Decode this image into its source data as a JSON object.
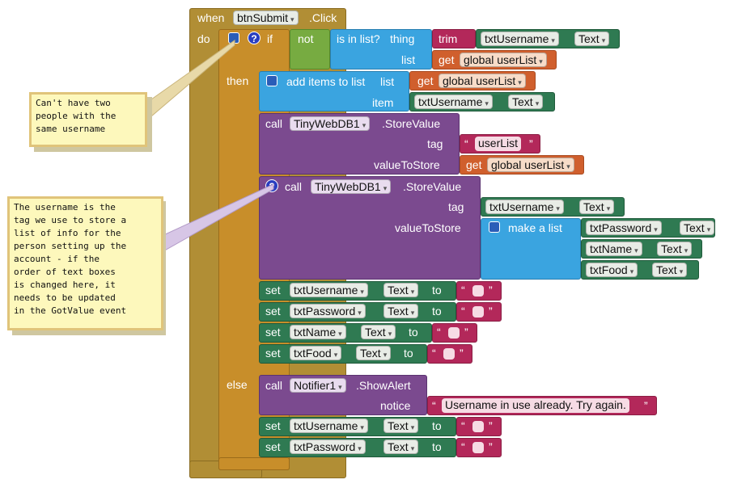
{
  "event": {
    "when": "when",
    "component": "btnSubmit",
    "event": ".Click",
    "do": "do"
  },
  "if_block": {
    "if": "if",
    "not": "not",
    "is_in_list": "is in list?",
    "thing": "thing",
    "list": "list",
    "trim": "trim",
    "then": "then",
    "else": "else"
  },
  "getters": {
    "get": "get",
    "user_list": "global userList"
  },
  "text_prop": "Text",
  "components": {
    "username": "txtUsername",
    "password": "txtPassword",
    "name": "txtName",
    "food": "txtFood",
    "db": "TinyWebDB1",
    "notifier": "Notifier1"
  },
  "add_items": {
    "label": "add items to list",
    "list": "list",
    "item": "item"
  },
  "store_value": {
    "call": "call",
    "method": ".StoreValue",
    "tag": "tag",
    "value": "valueToStore",
    "tag_value": "userList"
  },
  "make_list": "make a list",
  "set_kw": {
    "set": "set",
    "to": "to"
  },
  "alert": {
    "method": ".ShowAlert",
    "notice": "notice",
    "message": "Username in use already. Try again."
  },
  "quote_open": "“",
  "quote_close": "”",
  "comments": {
    "one": "Can't have two\npeople with the\nsame username",
    "two": "The username is the\ntag we use to store a\nlist of info for the\nperson setting up the\naccount - if the\norder of text boxes\nis changed here, it\nneeds to be updated\nin the GotValue event"
  },
  "colors": {
    "event": "#b18e35",
    "control": "#c88e2a",
    "logic": "#77ab41",
    "list": "#3aa4e0",
    "procedure": "#7b4a8f",
    "text": "#b3285a",
    "variable": "#d05f2d",
    "component": "#2f7a52",
    "note": "#fdf8bc"
  }
}
